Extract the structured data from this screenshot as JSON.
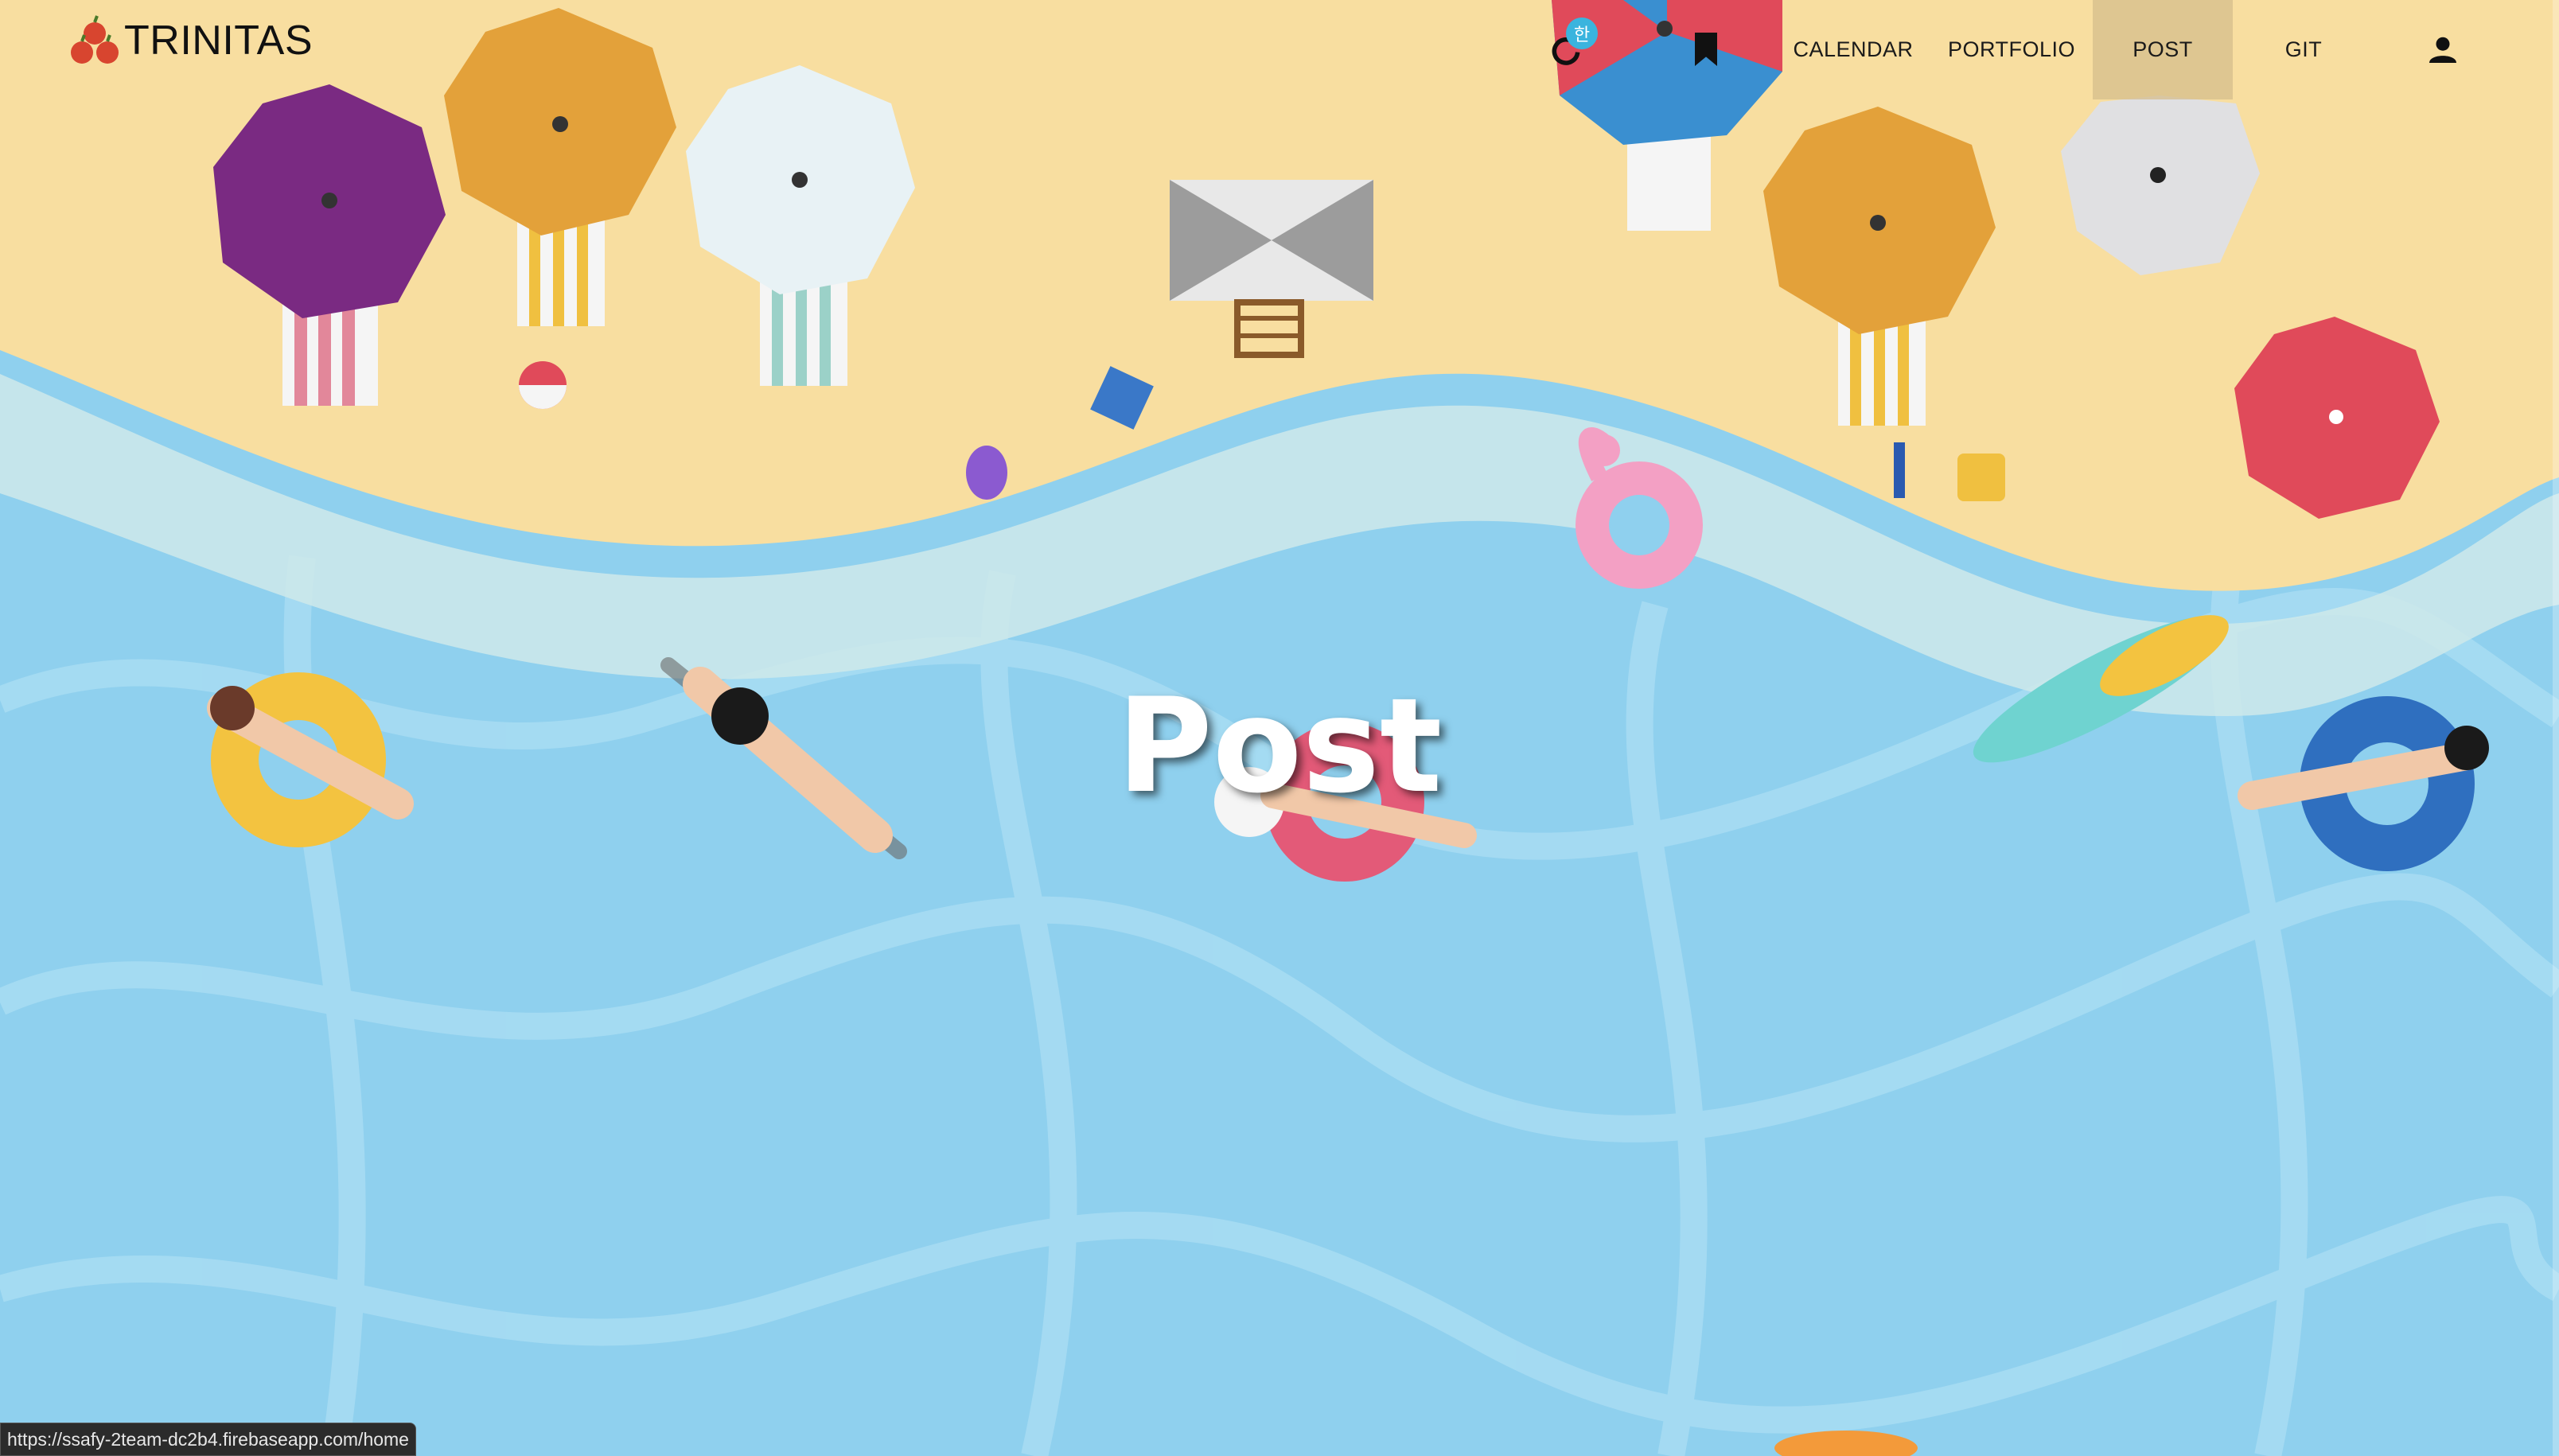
{
  "header": {
    "brand": "TRINITAS",
    "lang_badge": "한",
    "nav": [
      {
        "label": "CALENDAR"
      },
      {
        "label": "PORTFOLIO"
      },
      {
        "label": "POST"
      },
      {
        "label": "GIT"
      }
    ],
    "active_item": "POST"
  },
  "hero": {
    "title": "Post"
  },
  "status_bar": {
    "url": "https://ssafy-2team-dc2b4.firebaseapp.com/home"
  },
  "colors": {
    "sand": "#f8dea0",
    "water": "#8fd0ee",
    "active_nav": "#d6be8c"
  },
  "icons": [
    "apple-logo-icon",
    "refresh-icon",
    "bookmark-icon",
    "user-icon"
  ]
}
